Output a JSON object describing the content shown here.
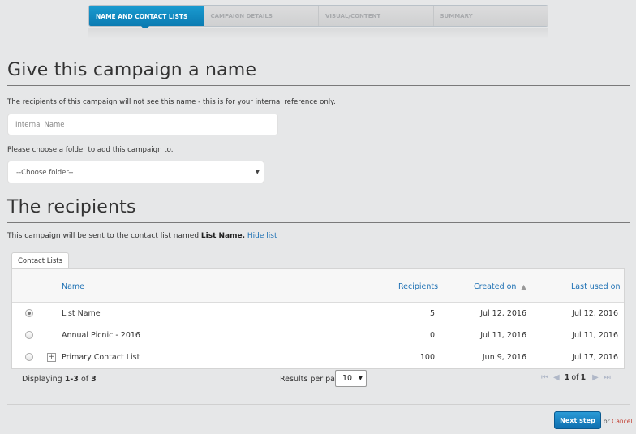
{
  "wizard": {
    "steps": [
      {
        "label": "NAME AND CONTACT LISTS",
        "active": true
      },
      {
        "label": "CAMPAIGN DETAILS",
        "active": false
      },
      {
        "label": "VISUAL/CONTENT",
        "active": false
      },
      {
        "label": "SUMMARY",
        "active": false
      }
    ]
  },
  "name_section": {
    "title": "Give this campaign a name",
    "description": "The recipients of this campaign will not see this name - this is for your internal reference only.",
    "name_placeholder": "Internal Name",
    "name_value": "",
    "folder_prompt": "Please choose a folder to add this campaign to.",
    "folder_selected": "--Choose folder--"
  },
  "recipients": {
    "title": "The recipients",
    "sent_to_prefix": "This campaign will be sent to the contact list named",
    "list_name": "List Name.",
    "hide_link": "Hide list",
    "tab_label": "Contact Lists",
    "columns": {
      "name": "Name",
      "recipients": "Recipients",
      "created_on": "Created on",
      "last_used_on": "Last used on"
    },
    "rows": [
      {
        "name": "List Name",
        "recipients": "5",
        "created": "Jul 12, 2016",
        "last_used": "Jul 12, 2016",
        "selected": true,
        "expandable": false
      },
      {
        "name": "Annual Picnic - 2016",
        "recipients": "0",
        "created": "Jul 11, 2016",
        "last_used": "Jul 11, 2016",
        "selected": false,
        "expandable": false
      },
      {
        "name": "Primary Contact List",
        "recipients": "100",
        "created": "Jun 9, 2016",
        "last_used": "Jul 17, 2016",
        "selected": false,
        "expandable": true
      }
    ],
    "pagination": {
      "displaying_prefix": "Displaying",
      "range": "1-3",
      "of_word": "of",
      "total": "3",
      "per_page_label": "Results per page:",
      "per_page_value": "10",
      "page_current": "1",
      "page_of": "of",
      "page_total": "1"
    }
  },
  "actions": {
    "next_label": "Next step",
    "or_word": "or",
    "cancel_label": "Cancel"
  },
  "colors": {
    "accent": "#0b7bb2",
    "link": "#1b6fb3",
    "cancel": "#c0392b"
  }
}
